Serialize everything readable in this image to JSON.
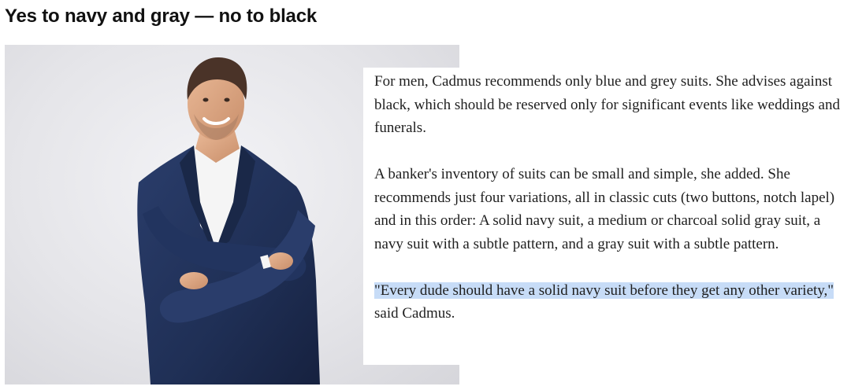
{
  "headline": "Yes to navy and gray — no to black",
  "photo": {
    "subject": "man-in-navy-suit",
    "background_color": "#e6e6ea",
    "suit_color": "#1f2f55",
    "shirt_color": "#f5f5f5"
  },
  "article": {
    "paragraph1": "For men, Cadmus recommends only blue and grey suits. She advises against black, which should be reserved only for significant events like weddings and funerals.",
    "paragraph2": "A banker's inventory of suits can be small and simple, she added. She recommends just four variations, all in classic cuts (two buttons, notch lapel) and in this order: A solid navy suit, a medium or charcoal solid gray suit, a navy suit with a subtle pattern, and a gray suit with a subtle pattern.",
    "quote_highlighted": "\"Every dude should have a solid navy suit before they get any other variety,\"",
    "quote_attribution": " said Cadmus."
  },
  "colors": {
    "highlight": "#c7dcf7",
    "text": "#1f1f1f",
    "headline": "#111111"
  }
}
